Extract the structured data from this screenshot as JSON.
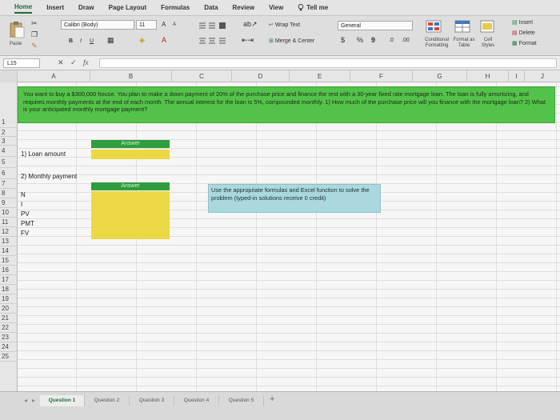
{
  "ribbon_tabs": [
    {
      "label": "Home",
      "active": true
    },
    {
      "label": "Insert"
    },
    {
      "label": "Draw"
    },
    {
      "label": "Page Layout"
    },
    {
      "label": "Formulas"
    },
    {
      "label": "Data"
    },
    {
      "label": "Review"
    },
    {
      "label": "View"
    }
  ],
  "tell_me": "Tell me",
  "clipboard": {
    "paste_label": "Paste"
  },
  "font": {
    "name": "Calibri (Body)",
    "size": "11",
    "grow": "A",
    "shrink": "A",
    "bold": "B",
    "italic": "I",
    "underline": "U"
  },
  "alignment": {
    "wrap_text": "Wrap Text",
    "merge_center": "Merge & Center"
  },
  "number": {
    "format": "General",
    "currency": "$",
    "percent": "%",
    "comma": "9"
  },
  "styles": {
    "conditional": "Conditional Formatting",
    "format_table": "Format as Table",
    "cell_styles": "Cell Styles"
  },
  "cells_group": {
    "insert": "Insert",
    "delete": "Delete",
    "format": "Format"
  },
  "formula_bar": {
    "name_box": "L15",
    "cancel": "✕",
    "confirm": "✓",
    "fx": "fx",
    "value": ""
  },
  "columns": [
    "A",
    "B",
    "C",
    "D",
    "E",
    "F",
    "G",
    "H",
    "I",
    "J"
  ],
  "rows": [
    "1",
    "2",
    "3",
    "4",
    "5",
    "6",
    "7",
    "8",
    "9",
    "10",
    "11",
    "12",
    "13",
    "14",
    "15",
    "16",
    "17",
    "18",
    "19",
    "20",
    "21",
    "22",
    "23",
    "24",
    "25"
  ],
  "sheet": {
    "problem": "You want to buy a $300,000 house. You plan to make a down payment of 20% of the purchase price and finance the rest with a 30-year fixed rate mortgage loan. The loan is fully amortizing, and requires monthly payments at the end of each month. The annual interest for the loan is 5%, compounded monthly. 1) How much of the purchase price will you finance with the mortgage loan? 2) What is your anticipated monthly mortgage payment?",
    "answer_header": "Answer",
    "answer_header_2": "Answer",
    "q1": "1) Loan amount",
    "q2": "2) Monthly payment",
    "labels": [
      "N",
      "I",
      "PV",
      "PMT",
      "FV"
    ],
    "note": "Use the appropriate formulas and Excel function to solve the problem (typed-in solutions receive 0 credit)"
  },
  "sheet_tabs": [
    {
      "label": "Question 1",
      "active": true
    },
    {
      "label": "Question 2"
    },
    {
      "label": "Question 3"
    },
    {
      "label": "Question 4"
    },
    {
      "label": "Question 5"
    }
  ],
  "colors": {
    "green_header": "#53c24a",
    "answer_green": "#2f9d3e",
    "yellow": "#ecd844",
    "note_blue": "#a9d8de"
  }
}
